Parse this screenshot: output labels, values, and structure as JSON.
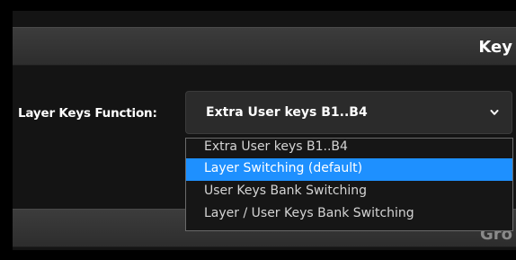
{
  "sections": {
    "top_title": "Key",
    "bottom_title": "Gro"
  },
  "layer_keys": {
    "label": "Layer Keys Function:",
    "selected_value": "Extra User keys B1..B4",
    "options": [
      {
        "label": "Extra User keys B1..B4",
        "highlighted": false
      },
      {
        "label": "Layer Switching (default)",
        "highlighted": true
      },
      {
        "label": "User Keys Bank Switching",
        "highlighted": false
      },
      {
        "label": "Layer / User Keys Bank Switching",
        "highlighted": false
      }
    ]
  },
  "colors": {
    "highlight": "#1e90ff",
    "background": "#000000",
    "header": "#363636"
  },
  "icons": {
    "dropdown": "chevron-down-icon"
  }
}
